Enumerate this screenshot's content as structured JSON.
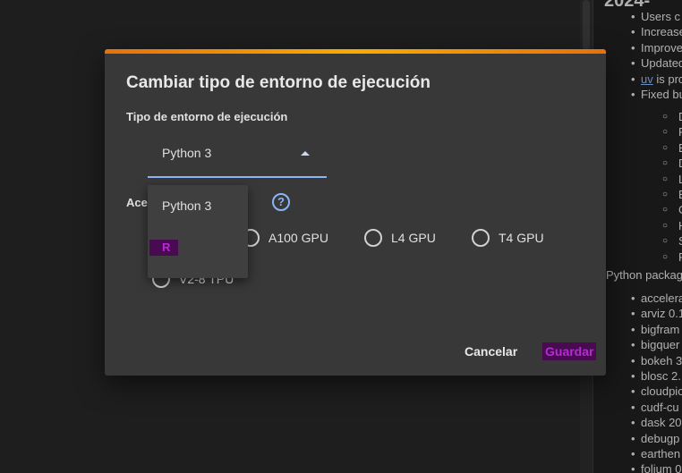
{
  "notes": {
    "title": "2024-",
    "bullets": [
      "Users c",
      "Increase",
      "Improve",
      "Updated",
      "is pro",
      "Fixed bu"
    ],
    "link": "uv",
    "sub_bullets": [
      "D",
      "P",
      "B",
      "D",
      "L",
      "E",
      "C",
      "H",
      "S",
      "P"
    ],
    "packages_heading": "Python packag",
    "packages": [
      "accelera",
      "arviz 0.1",
      "bigfram",
      "bigquer",
      "bokeh 3",
      "blosc 2.",
      "cloudpic",
      "cudf-cu",
      "dask 20",
      "debugp",
      "earthen",
      "folium 0"
    ]
  },
  "dialog": {
    "title": "Cambiar tipo de entorno de ejecución",
    "runtime_label": "Tipo de entorno de ejecución",
    "runtime_value": "Python 3",
    "accelerator_label_prefix": "Ace",
    "accelerator_label_suffix": "are",
    "help_icon": "?",
    "accelerators": [
      "A100 GPU",
      "L4 GPU",
      "T4 GPU",
      "V2-8 TPU"
    ],
    "cancel_label": "Cancelar",
    "save_label": "Guardar"
  },
  "menu": {
    "options": [
      "Python 3",
      "R"
    ]
  },
  "colors": {
    "accent_orange": "#f9ab00",
    "focus_blue": "#8ab4f8",
    "highlight_magenta": "#b42bd1"
  }
}
